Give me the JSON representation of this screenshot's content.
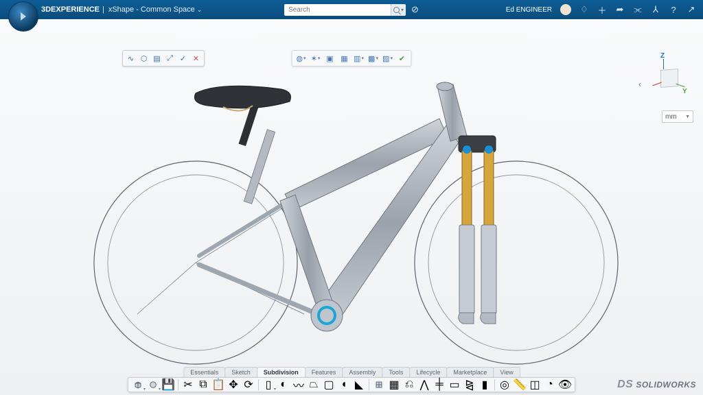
{
  "header": {
    "brand": "3DEXPERIENCE",
    "separator": "|",
    "app_name": "xShape - Common Space",
    "search_placeholder": "Search",
    "user_name": "Ed ENGINEER"
  },
  "mini_toolbar": {
    "tools": [
      "spline",
      "profile",
      "extrude",
      "scale",
      "accept",
      "cancel"
    ]
  },
  "sketch_toolbar": {
    "tools": [
      "globe",
      "axis",
      "orient",
      "fit",
      "shade",
      "wire",
      "render",
      "ok"
    ]
  },
  "triad": {
    "z": "Z",
    "y": "Y"
  },
  "units": {
    "label": "mm"
  },
  "tabs": [
    {
      "label": "Essentials",
      "active": false
    },
    {
      "label": "Sketch",
      "active": false
    },
    {
      "label": "Subdivision",
      "active": true
    },
    {
      "label": "Features",
      "active": false
    },
    {
      "label": "Assembly",
      "active": false
    },
    {
      "label": "Tools",
      "active": false
    },
    {
      "label": "Lifecycle",
      "active": false
    },
    {
      "label": "Marketplace",
      "active": false
    },
    {
      "label": "View",
      "active": false
    }
  ],
  "brand_footer": {
    "ds": "DS",
    "name": "SOLIDWORKS"
  }
}
